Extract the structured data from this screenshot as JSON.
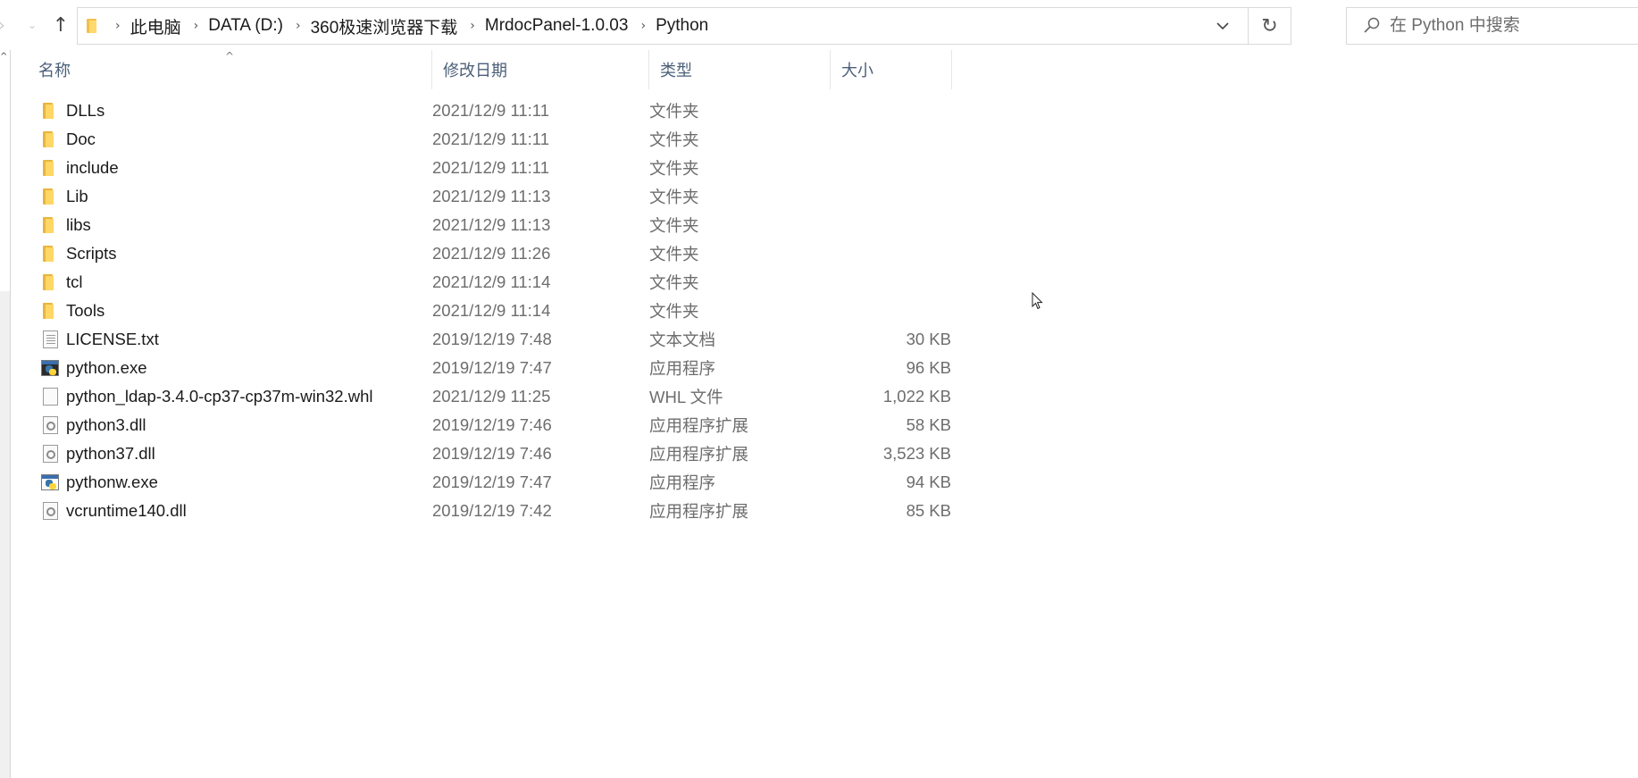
{
  "address": {
    "crumbs": [
      "此电脑",
      "DATA (D:)",
      "360极速浏览器下载",
      "MrdocPanel-1.0.03",
      "Python"
    ]
  },
  "search": {
    "placeholder": "在 Python 中搜索"
  },
  "columns": {
    "name": "名称",
    "date": "修改日期",
    "type": "类型",
    "size": "大小"
  },
  "files": [
    {
      "name": "DLLs",
      "date": "2021/12/9 11:11",
      "type": "文件夹",
      "size": "",
      "icon": "folder-icon"
    },
    {
      "name": "Doc",
      "date": "2021/12/9 11:11",
      "type": "文件夹",
      "size": "",
      "icon": "folder-icon"
    },
    {
      "name": "include",
      "date": "2021/12/9 11:11",
      "type": "文件夹",
      "size": "",
      "icon": "folder-icon"
    },
    {
      "name": "Lib",
      "date": "2021/12/9 11:13",
      "type": "文件夹",
      "size": "",
      "icon": "folder-icon"
    },
    {
      "name": "libs",
      "date": "2021/12/9 11:13",
      "type": "文件夹",
      "size": "",
      "icon": "folder-icon"
    },
    {
      "name": "Scripts",
      "date": "2021/12/9 11:26",
      "type": "文件夹",
      "size": "",
      "icon": "folder-icon"
    },
    {
      "name": "tcl",
      "date": "2021/12/9 11:14",
      "type": "文件夹",
      "size": "",
      "icon": "folder-icon"
    },
    {
      "name": "Tools",
      "date": "2021/12/9 11:14",
      "type": "文件夹",
      "size": "",
      "icon": "folder-icon"
    },
    {
      "name": "LICENSE.txt",
      "date": "2019/12/19 7:48",
      "type": "文本文档",
      "size": "30 KB",
      "icon": "text-file-icon"
    },
    {
      "name": "python.exe",
      "date": "2019/12/19 7:47",
      "type": "应用程序",
      "size": "96 KB",
      "icon": "python-exe-icon"
    },
    {
      "name": "python_ldap-3.4.0-cp37-cp37m-win32.whl",
      "date": "2021/12/9 11:25",
      "type": "WHL 文件",
      "size": "1,022 KB",
      "icon": "blank-file-icon"
    },
    {
      "name": "python3.dll",
      "date": "2019/12/19 7:46",
      "type": "应用程序扩展",
      "size": "58 KB",
      "icon": "dll-file-icon"
    },
    {
      "name": "python37.dll",
      "date": "2019/12/19 7:46",
      "type": "应用程序扩展",
      "size": "3,523 KB",
      "icon": "dll-file-icon"
    },
    {
      "name": "pythonw.exe",
      "date": "2019/12/19 7:47",
      "type": "应用程序",
      "size": "94 KB",
      "icon": "pythonw-exe-icon"
    },
    {
      "name": "vcruntime140.dll",
      "date": "2019/12/19 7:42",
      "type": "应用程序扩展",
      "size": "85 KB",
      "icon": "dll-file-icon"
    }
  ]
}
